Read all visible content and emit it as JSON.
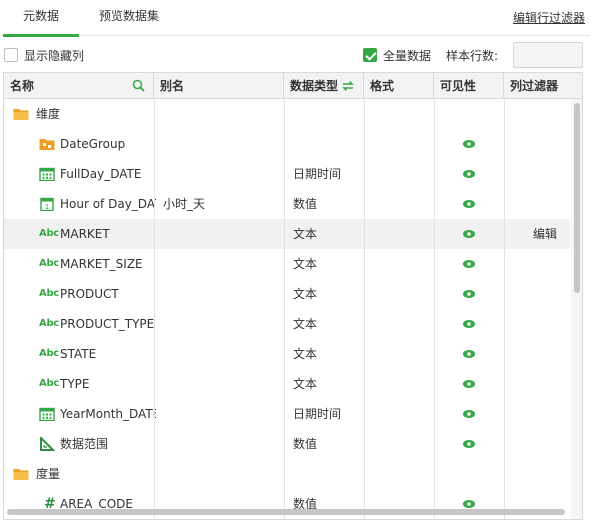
{
  "tabs": [
    {
      "label": "元数据",
      "active": true
    },
    {
      "label": "预览数据集",
      "active": false
    }
  ],
  "row_filter_link": "编辑行过滤器",
  "options": {
    "show_hidden_label": "显示隐藏列",
    "show_hidden_checked": false,
    "all_data_label": "全量数据",
    "all_data_checked": true,
    "sample_rows_label": "样本行数:",
    "sample_rows_value": ""
  },
  "columns": {
    "name": "名称",
    "alias": "别名",
    "datatype": "数据类型",
    "format": "格式",
    "visibility": "可见性",
    "column_filter": "列过滤器"
  },
  "rows": [
    {
      "kind": "group",
      "icon": "folder-icon",
      "name": "维度"
    },
    {
      "kind": "field",
      "icon": "hierarchy-folder-icon",
      "name": "DateGroup",
      "alias": "",
      "datatype": "",
      "visible": true,
      "filter": ""
    },
    {
      "kind": "field",
      "icon": "calendar-icon",
      "name": "FullDay_DATE",
      "alias": "",
      "datatype": "日期时间",
      "visible": true,
      "filter": ""
    },
    {
      "kind": "field",
      "icon": "calendar-day-icon",
      "name": "Hour of Day_DAT",
      "alias": "小时_天",
      "datatype": "数值",
      "visible": true,
      "filter": ""
    },
    {
      "kind": "field",
      "icon": "text-type-icon",
      "name": "MARKET",
      "alias": "",
      "datatype": "文本",
      "visible": true,
      "filter": "编辑",
      "highlighted": true
    },
    {
      "kind": "field",
      "icon": "text-type-icon",
      "name": "MARKET_SIZE",
      "alias": "",
      "datatype": "文本",
      "visible": true,
      "filter": ""
    },
    {
      "kind": "field",
      "icon": "text-type-icon",
      "name": "PRODUCT",
      "alias": "",
      "datatype": "文本",
      "visible": true,
      "filter": ""
    },
    {
      "kind": "field",
      "icon": "text-type-icon",
      "name": "PRODUCT_TYPE",
      "alias": "",
      "datatype": "文本",
      "visible": true,
      "filter": ""
    },
    {
      "kind": "field",
      "icon": "text-type-icon",
      "name": "STATE",
      "alias": "",
      "datatype": "文本",
      "visible": true,
      "filter": ""
    },
    {
      "kind": "field",
      "icon": "text-type-icon",
      "name": "TYPE",
      "alias": "",
      "datatype": "文本",
      "visible": true,
      "filter": ""
    },
    {
      "kind": "field",
      "icon": "calendar-icon",
      "name": "YearMonth_DATE",
      "alias": "",
      "datatype": "日期时间",
      "visible": true,
      "filter": ""
    },
    {
      "kind": "field",
      "icon": "range-icon",
      "name": "数据范围",
      "alias": "",
      "datatype": "数值",
      "visible": true,
      "filter": ""
    },
    {
      "kind": "group",
      "icon": "folder-icon",
      "name": "度量"
    },
    {
      "kind": "field",
      "icon": "number-type-icon",
      "name": "AREA_CODE",
      "alias": "",
      "datatype": "数值",
      "visible": true,
      "filter": ""
    }
  ],
  "colors": {
    "accent": "#35a845",
    "header_bg": "#f3f3f3",
    "highlight_row": "#f1f1f1",
    "folder": "#f5a623"
  }
}
